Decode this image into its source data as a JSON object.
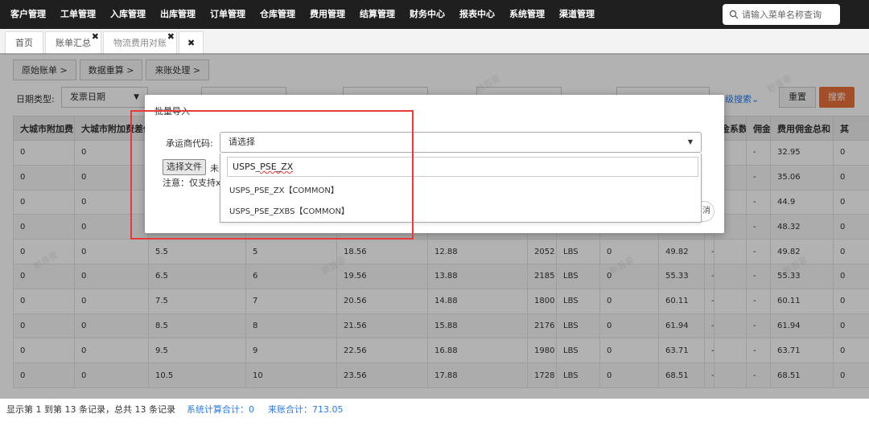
{
  "topnav": {
    "menu": [
      "客户管理",
      "工单管理",
      "入库管理",
      "出库管理",
      "订单管理",
      "仓库管理",
      "费用管理",
      "结算管理",
      "财务中心",
      "报表中心",
      "系统管理",
      "渠道管理"
    ],
    "search_placeholder": "请输入菜单名称查询"
  },
  "tabs": [
    {
      "label": "首页"
    },
    {
      "label": "账单汇总",
      "close": "✖"
    },
    {
      "label": "物流费用对账",
      "close": "✖"
    },
    {
      "label": "✖"
    }
  ],
  "crumbs": [
    "原始账单 >",
    "数据重算 >",
    "来账处理 >"
  ],
  "filters": {
    "date_type_label": "日期类型:",
    "date_type_value": "发票日期",
    "advanced": "高级搜索⌄",
    "reset": "重置",
    "search": "搜索"
  },
  "table": {
    "headers": [
      "大城市附加费",
      "大城市附加费差价",
      "",
      "",
      "",
      "",
      "",
      "",
      "",
      "",
      "",
      "",
      "",
      "金系数",
      "佣金",
      "费用佣金总和",
      "其"
    ],
    "rows": [
      [
        "0",
        "0",
        "",
        "",
        "",
        "",
        "",
        "",
        "",
        "",
        "",
        "",
        "",
        "",
        "-",
        "32.95",
        "0"
      ],
      [
        "0",
        "0",
        "",
        "",
        "",
        "",
        "",
        "",
        "",
        "",
        "",
        "",
        "",
        "",
        "-",
        "35.06",
        "0"
      ],
      [
        "0",
        "0",
        "",
        "",
        "",
        "",
        "",
        "",
        "",
        "",
        "",
        "",
        "",
        "",
        "-",
        "44.9",
        "0"
      ],
      [
        "0",
        "0",
        "",
        "",
        "",
        "",
        "",
        "",
        "",
        "",
        "",
        "",
        "",
        "",
        "-",
        "48.32",
        "0"
      ],
      [
        "0",
        "0",
        "5.5",
        "5",
        "18.56",
        "12.88",
        "2052",
        "LBS",
        "0",
        "49.82",
        "-",
        "",
        "",
        "",
        "-",
        "49.82",
        "0"
      ],
      [
        "0",
        "0",
        "6.5",
        "6",
        "19.56",
        "13.88",
        "2185",
        "LBS",
        "0",
        "55.33",
        "-",
        "",
        "",
        "",
        "-",
        "55.33",
        "0"
      ],
      [
        "0",
        "0",
        "7.5",
        "7",
        "20.56",
        "14.88",
        "1800",
        "LBS",
        "0",
        "60.11",
        "-",
        "",
        "",
        "",
        "-",
        "60.11",
        "0"
      ],
      [
        "0",
        "0",
        "8.5",
        "8",
        "21.56",
        "15.88",
        "2176",
        "LBS",
        "0",
        "61.94",
        "-",
        "",
        "",
        "",
        "-",
        "61.94",
        "0"
      ],
      [
        "0",
        "0",
        "9.5",
        "9",
        "22.56",
        "16.88",
        "1980",
        "LBS",
        "0",
        "63.71",
        "-",
        "",
        "",
        "",
        "-",
        "63.71",
        "0"
      ],
      [
        "0",
        "0",
        "10.5",
        "10",
        "23.56",
        "17.88",
        "1728",
        "LBS",
        "0",
        "68.51",
        "-",
        "",
        "",
        "",
        "-",
        "68.51",
        "0"
      ]
    ]
  },
  "footer": {
    "records": "显示第 1 到第 13 条记录，总共 13 条记录",
    "system_total": "系统计算合计：0",
    "incoming_total": "来账合计：713.05"
  },
  "modal": {
    "title": "批量导入",
    "carrier_label": "承运商代码:",
    "carrier_placeholder": "请选择",
    "file_button": "选择文件",
    "file_status": "未",
    "note": "注意：仅支持xl",
    "close_label": "消"
  },
  "dropdown": {
    "search_prefix": "USPS_",
    "search_rest": "PSE_ZX",
    "options": [
      "USPS_PSE_ZX【COMMON】",
      "USPS_PSE_ZXBS【COMMON】"
    ]
  },
  "watermark": "赖晋豪",
  "colors": {
    "accent_orange": "#e8703a",
    "link_blue": "#2a7ae2",
    "highlight_red": "#e83a3a",
    "nav_bg": "#1f1f1f"
  }
}
